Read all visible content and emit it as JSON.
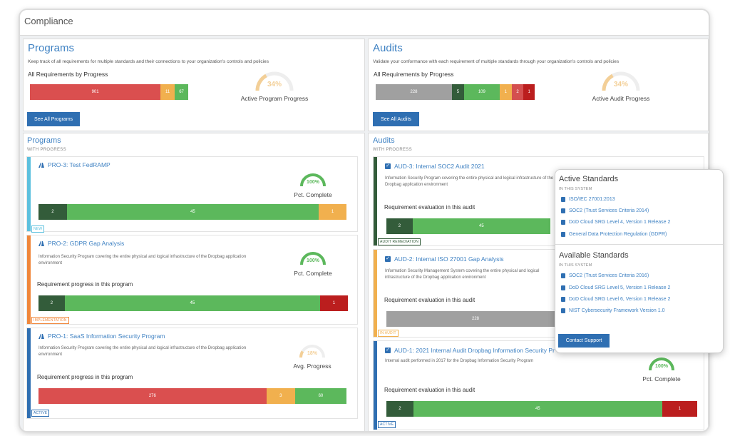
{
  "header": {
    "title": "Compliance"
  },
  "programs_summary": {
    "title": "Programs",
    "description": "Keep track of all requirements for multiple standards and their connections to your organization's controls and policies",
    "bar_heading": "All Requirements by Progress",
    "segments": [
      {
        "value": "901",
        "fraction": 0.825,
        "color": "#da4f4f"
      },
      {
        "value": "11",
        "fraction": 0.09,
        "color": "#f1b04e"
      },
      {
        "value": "67",
        "fraction": 0.085,
        "color": "#5cb85c"
      }
    ],
    "gauge_value": "34%",
    "gauge_fraction": 0.34,
    "gauge_label": "Active Program Progress",
    "button_label": "See All Programs"
  },
  "audits_summary": {
    "title": "Audits",
    "description": "Validate your conformance with each requirement of multiple standards through your organization's controls and policies",
    "bar_heading": "All Requirements by Progress",
    "segments": [
      {
        "value": "228",
        "fraction": 0.48,
        "color": "#a0a0a0"
      },
      {
        "value": "5",
        "fraction": 0.075,
        "color": "#335c3a"
      },
      {
        "value": "109",
        "fraction": 0.225,
        "color": "#5cb85c"
      },
      {
        "value": "1",
        "fraction": 0.075,
        "color": "#f1b04e"
      },
      {
        "value": "2",
        "fraction": 0.075,
        "color": "#d44f4f"
      },
      {
        "value": "1",
        "fraction": 0.07,
        "color": "#bb1e1e"
      }
    ],
    "gauge_value": "34%",
    "gauge_fraction": 0.34,
    "gauge_label": "Active Audit Progress",
    "button_label": "See All Audits"
  },
  "programs_list": {
    "title": "Programs",
    "caption": "WITH PROGRESS",
    "cards": [
      {
        "title": "PRO-3: Test FedRAMP",
        "description": "",
        "sub": "",
        "gauge_value": "100%",
        "gauge_fraction": 1.0,
        "gauge_label": "Pct. Complete",
        "badge": "NEW",
        "stripe": "#5bc0de",
        "segments": [
          {
            "value": "2",
            "fraction": 0.092,
            "color": "#335c3a"
          },
          {
            "value": "45",
            "fraction": 0.818,
            "color": "#5cb85c"
          },
          {
            "value": "1",
            "fraction": 0.09,
            "color": "#f1b04e"
          }
        ]
      },
      {
        "title": "PRO-2: GDPR Gap Analysis",
        "description": "Information Security Program covering the entire physical and logical infrastructure of the Dropbag application environment",
        "sub": "Requirement progress in this program",
        "gauge_value": "100%",
        "gauge_fraction": 1.0,
        "gauge_label": "Pct. Complete",
        "badge": "IMPLEMENTATION",
        "stripe": "#f0863a",
        "segments": [
          {
            "value": "2",
            "fraction": 0.085,
            "color": "#335c3a"
          },
          {
            "value": "45",
            "fraction": 0.825,
            "color": "#5cb85c"
          },
          {
            "value": "1",
            "fraction": 0.09,
            "color": "#bb1e1e"
          }
        ]
      },
      {
        "title": "PRO-1: SaaS Information Security Program",
        "description": "Information Security Program covering the entire physical and logical infrastructure of the Dropbag application environment",
        "sub": "Requirement progress in this program",
        "gauge_value": "18%",
        "gauge_fraction": 0.18,
        "gauge_label": "Avg. Progress",
        "badge": "ACTIVE",
        "stripe": "#2f6fb2",
        "segments": [
          {
            "value": "276",
            "fraction": 0.74,
            "color": "#da4f4f"
          },
          {
            "value": "3",
            "fraction": 0.093,
            "color": "#f1b04e"
          },
          {
            "value": "60",
            "fraction": 0.167,
            "color": "#5cb85c"
          }
        ]
      }
    ]
  },
  "audits_list": {
    "title": "Audits",
    "caption": "WITH PROGRESS",
    "cards": [
      {
        "title": "AUD-3: Internal SOC2 Audit 2021",
        "description": "Information Security Program covering the entire physical and logical infrastructure of the Dropbag application environment",
        "sub": "Requirement evaluation in this audit",
        "badge": "AUDIT REMEDIATION",
        "stripe": "#335c3a",
        "segments": [
          {
            "value": "2",
            "fraction": 0.16,
            "color": "#335c3a"
          },
          {
            "value": "45",
            "fraction": 0.84,
            "color": "#5cb85c"
          }
        ]
      },
      {
        "title": "AUD-2: Internal ISO 27001 Gap Analysis",
        "description": "Information Security Management System covering the entire physical and logical infrastructure of the Dropbag application environment",
        "sub": "Requirement evaluation in this audit",
        "badge": "IN AUDIT",
        "stripe": "#f1b04e",
        "segments": [
          {
            "value": "228",
            "fraction": 1.0,
            "color": "#a0a0a0"
          }
        ]
      },
      {
        "title": "AUD-1: 2021 Internal Audit Dropbag Information Security Pr",
        "description": "Internal audit performed in 2017 for the Dropbag Information Security Program",
        "sub": "Requirement evaluation in this audit",
        "gauge_value": "100%",
        "gauge_fraction": 1.0,
        "gauge_label": "Pct. Complete",
        "badge": "ACTIVE",
        "stripe": "#2f6fb2",
        "segments": [
          {
            "value": "2",
            "fraction": 0.087,
            "color": "#335c3a"
          },
          {
            "value": "45",
            "fraction": 0.8,
            "color": "#5cb85c"
          },
          {
            "value": "1",
            "fraction": 0.113,
            "color": "#bb1e1e"
          }
        ]
      }
    ]
  },
  "standards_popover": {
    "active_title": "Active Standards",
    "active_caption": "IN THIS SYSTEM",
    "active_items": [
      "ISO/IEC 27001:2013",
      "SOC2 (Trust Services Criteria 2014)",
      "DoD Cloud SRG Level 4, Version 1 Release 2",
      "General Data Protection Regulation (GDPR)"
    ],
    "available_title": "Available Standards",
    "available_caption": "IN THIS SYSTEM",
    "available_items": [
      "SOC2 (Trust Services Criteria 2016)",
      "DoD Cloud SRG Level 5, Version 1 Release 2",
      "DoD Cloud SRG Level 6, Version 1 Release 2",
      "NIST Cybersecurity Framework Version 1.0"
    ],
    "button_label": "Contact Support"
  },
  "colors": {
    "accent": "#3f82c3",
    "button": "#2f6fb2",
    "gauge": "#f3cf97",
    "gauge_complete": "#5cb85c"
  }
}
